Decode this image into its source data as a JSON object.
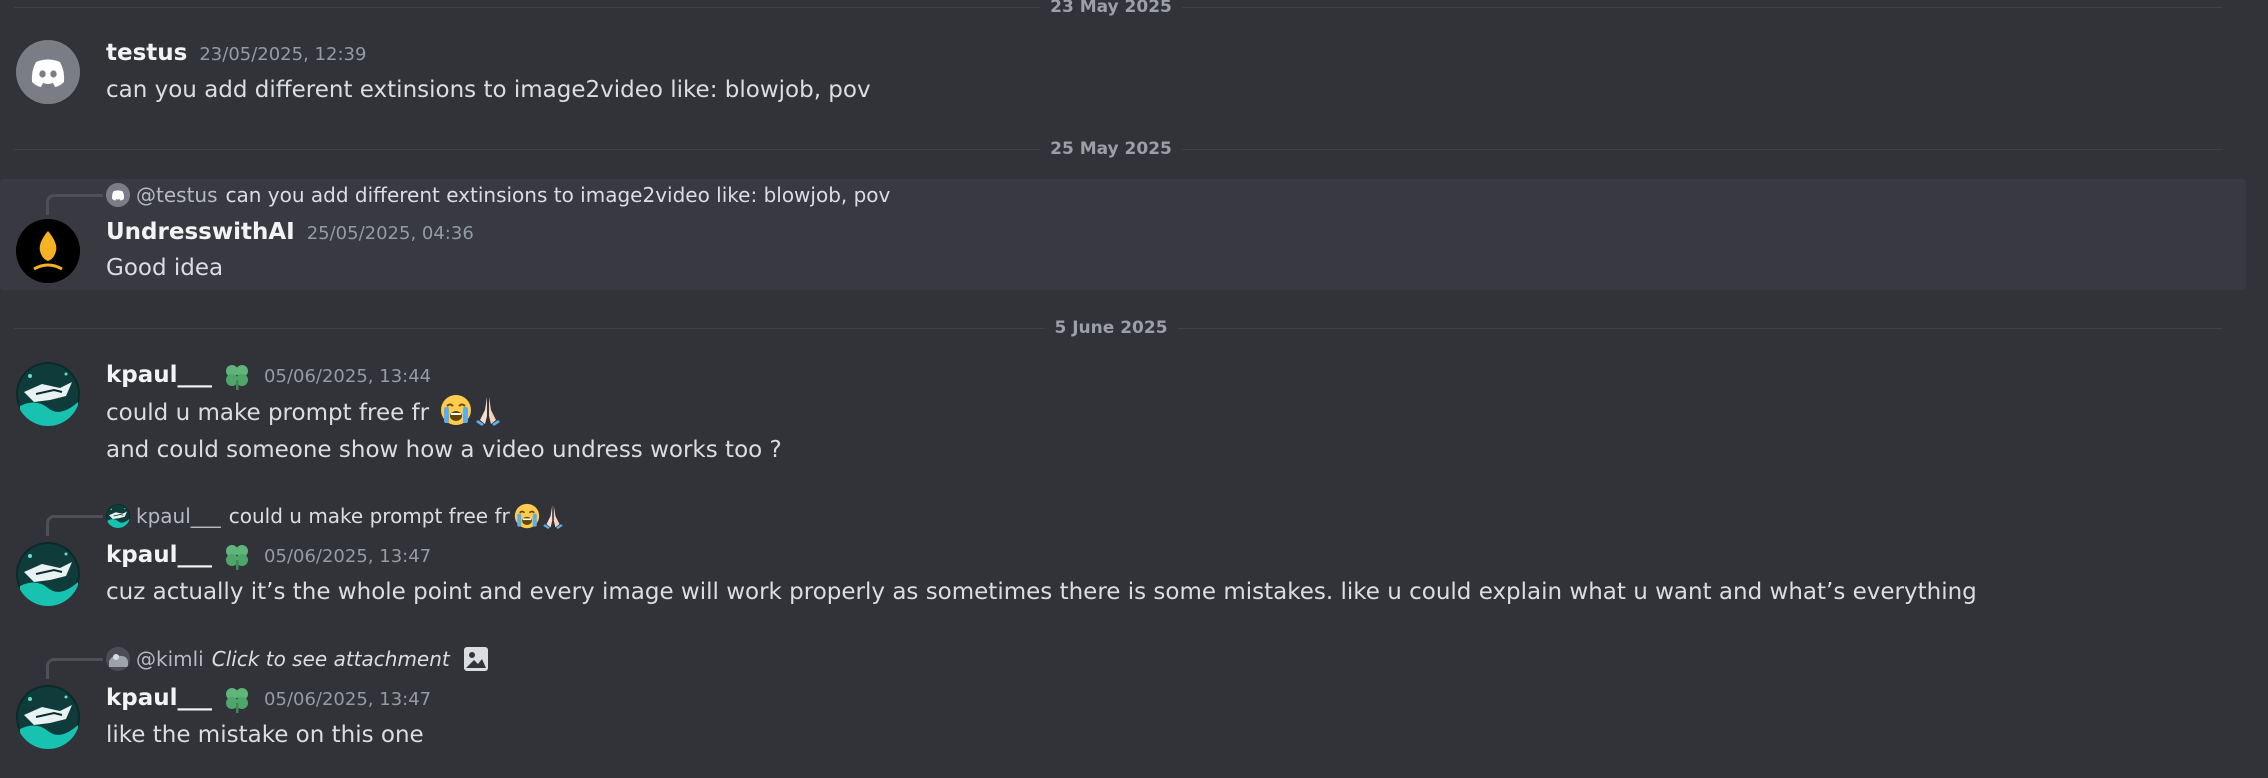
{
  "dividers": {
    "d1": "23 May 2025",
    "d2": "25 May 2025",
    "d3": "5 June 2025"
  },
  "messages": [
    {
      "author": "testus",
      "timestamp": "23/05/2025, 12:39",
      "text": "can you add different extinsions to image2video like: blowjob, pov",
      "avatar_icon": "discord-logo-icon"
    },
    {
      "reply_to": {
        "mention": "@testus",
        "text": "can you add different extinsions to image2video like: blowjob, pov"
      },
      "author": "UndresswithAI",
      "timestamp": "25/05/2025, 04:36",
      "text": "Good idea",
      "avatar_icon": "flame-logo-icon"
    },
    {
      "author": "kpaul___",
      "badge_icon": "clover-badge-icon",
      "timestamp": "05/06/2025, 13:44",
      "text": "could u make prompt free fr",
      "emojis": [
        "loudly-crying-face",
        "folded-hands"
      ],
      "followup_text": "and could someone show how a video undress works too ?"
    },
    {
      "reply_to": {
        "mention": "kpaul___",
        "text": "could u make prompt free fr",
        "emojis": [
          "loudly-crying-face",
          "folded-hands"
        ]
      },
      "author": "kpaul___",
      "badge_icon": "clover-badge-icon",
      "timestamp": "05/06/2025, 13:47",
      "text": "cuz actually it’s the whole point and every image will work properly as sometimes there is some mistakes. like u could explain what u want and what’s everything"
    },
    {
      "reply_to": {
        "mention": "@kimli",
        "text": "Click to see attachment",
        "icon": "image-attachment-icon"
      },
      "author": "kpaul___",
      "badge_icon": "clover-badge-icon",
      "timestamp": "05/06/2025, 13:47",
      "text": "like the mistake on this one"
    }
  ],
  "colors": {
    "background": "#323339",
    "highlight": "#393a41",
    "discord_blurple": "#5865f2",
    "grey_avatar": "#7a7d86",
    "badge_green": "#5fb57a"
  }
}
